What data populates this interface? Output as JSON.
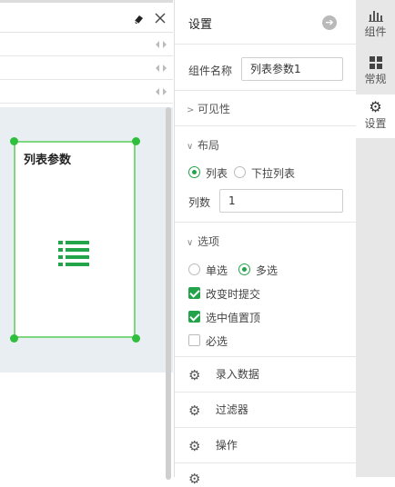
{
  "panel": {
    "title": "设置",
    "component_name_label": "组件名称",
    "component_name_value": "列表参数1",
    "sections": {
      "visibility": "可见性",
      "layout": "布局",
      "options": "选项"
    },
    "layout": {
      "radio_list": "列表",
      "radio_dropdown": "下拉列表",
      "columns_label": "列数",
      "columns_value": "1"
    },
    "options": {
      "single_select": "单选",
      "multi_select": "多选",
      "submit_on_change": "改变时提交",
      "selected_on_top": "选中值置顶",
      "required": "必选"
    },
    "actions": {
      "enter_data": "录入数据",
      "filter": "过滤器",
      "operation": "操作"
    }
  },
  "tabs": [
    {
      "label": "组件",
      "icon": "bar-chart-icon"
    },
    {
      "label": "常规",
      "icon": "grid-icon"
    },
    {
      "label": "设置",
      "icon": "gear-icon"
    }
  ],
  "widget": {
    "title": "列表参数",
    "icon": "list-icon"
  },
  "colors": {
    "accent": "#23a34a",
    "selection": "#7dd87f"
  }
}
